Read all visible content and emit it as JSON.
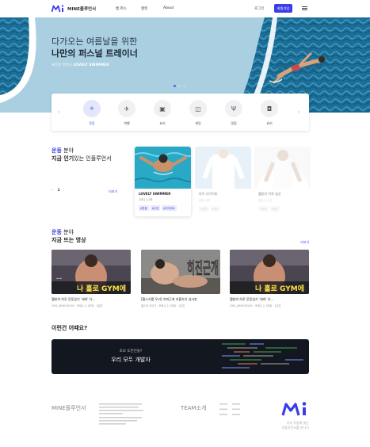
{
  "header": {
    "brand": "MINE플루언서",
    "nav": [
      "캠 퍼스",
      "랭킹",
      "About"
    ],
    "login": "로그인",
    "signup": "회원가입"
  },
  "hero": {
    "line1": "다가오는 여름날을 위한",
    "line2": "나만의 퍼스널 트레이너",
    "tag_prefix": "#운동 인미니",
    "tag_name": "LOVELY SWIMMER",
    "slides": 3,
    "active_slide": 1
  },
  "categories": [
    {
      "label": "운동",
      "icon": "dumbbell-icon",
      "glyph": "⟡",
      "active": true
    },
    {
      "label": "여행",
      "icon": "airplane-icon",
      "glyph": "✈",
      "active": false
    },
    {
      "label": "요리",
      "icon": "pot-icon",
      "glyph": "▣",
      "active": false
    },
    {
      "label": "게임",
      "icon": "gamepad-icon",
      "glyph": "◫",
      "active": false
    },
    {
      "label": "맛집",
      "icon": "fork-knife-icon",
      "glyph": "Ψ",
      "active": false
    },
    {
      "label": "요리",
      "icon": "bag-icon",
      "glyph": "◘",
      "active": false
    }
  ],
  "section1": {
    "hl": "운동",
    "title_rest": " 분야",
    "line2": "지금 인기",
    "line2_thin": "있는 인플루언서",
    "pager_current": "1",
    "more": "더보기"
  },
  "cards": [
    {
      "name": "LOVELY SWIMMER",
      "sub": "수영 | 1.2만",
      "tags": [
        "#운동",
        "#수영",
        "#다이어트"
      ]
    },
    {
      "name": "마이 다이어트",
      "sub": "운동 | 8천",
      "tags": [
        "#운동",
        "#헬스"
      ]
    },
    {
      "name": "헬창의 하루 일상",
      "sub": "운동 | 1.1만",
      "tags": [
        "#운동",
        "#헬스"
      ]
    }
  ],
  "section2": {
    "hl": "운동",
    "title_rest": " 분야",
    "line2": "지금 뜨는 영상",
    "more": "더보기"
  },
  "videos": [
    {
      "title": "헬창의 하루 운동일기 '세바' 다...",
      "meta": "GYM_ARMHODOK · 조회수 2.1만회 · 1일전",
      "overlay": "나 홀로 GYM에",
      "kind": "gym"
    },
    {
      "title": "[헬스가를 우리] 히피근개 지불하기 실사판",
      "meta": "헬스의 이야기 · 조회수 2.1만회 · 1일전",
      "overlay": "히진근개",
      "kind": "pt"
    },
    {
      "title": "헬창의 하루 운동일기 '세바' 다...",
      "meta": "GYM_ARMHODOK · 조회수 2.1만회 · 1일전",
      "overlay": "나 홀로 GYM에",
      "kind": "gym"
    }
  ],
  "section3": {
    "title": "이런건 어때요?"
  },
  "banner": {
    "line1": "초보 도전인들?",
    "line2": "우리 모두 개발자"
  },
  "footer": {
    "brand": "MINE플루언서",
    "team": "TEAM소개",
    "slogan1": "너의 작업에 맞는",
    "slogan2": "인플루언서를 만나다"
  },
  "colors": {
    "accent": "#3b3ee8",
    "hero_bg": "#a9cfe0",
    "banner_bg": "#131720"
  }
}
